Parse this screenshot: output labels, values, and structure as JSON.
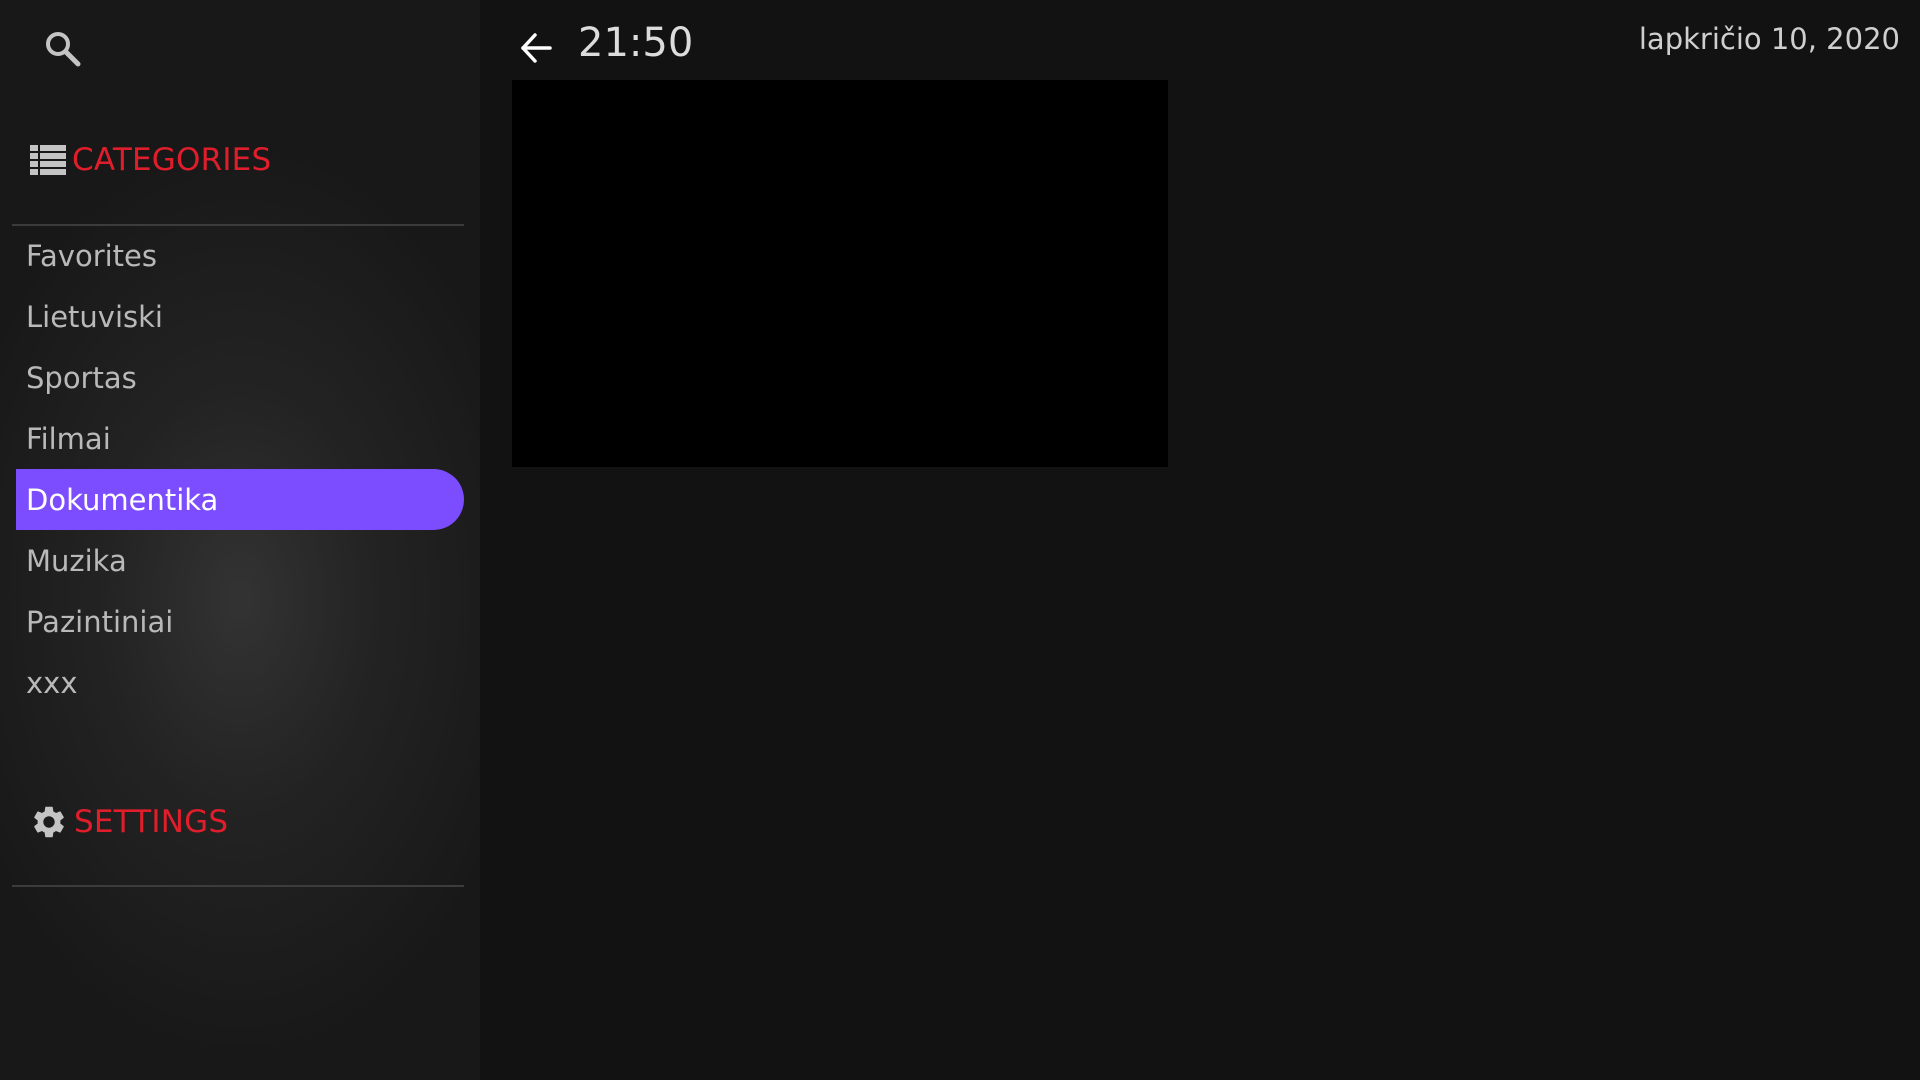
{
  "header": {
    "time": "21:50",
    "date": "lapkričio 10, 2020"
  },
  "sidebar": {
    "categories_title": "CATEGORIES",
    "settings_title": "SETTINGS",
    "items": [
      {
        "label": "Favorites",
        "active": false
      },
      {
        "label": "Lietuviski",
        "active": false
      },
      {
        "label": "Sportas",
        "active": false
      },
      {
        "label": "Filmai",
        "active": false
      },
      {
        "label": "Dokumentika",
        "active": true
      },
      {
        "label": "Muzika",
        "active": false
      },
      {
        "label": "Pazintiniai",
        "active": false
      },
      {
        "label": "xxx",
        "active": false
      }
    ]
  },
  "icons": {
    "search": "search-icon",
    "categories": "list-icon",
    "settings": "gear-icon",
    "back": "arrow-back-icon"
  },
  "colors": {
    "accent_red": "#e01e2b",
    "active_item": "#7c4dff",
    "background": "#121212"
  }
}
